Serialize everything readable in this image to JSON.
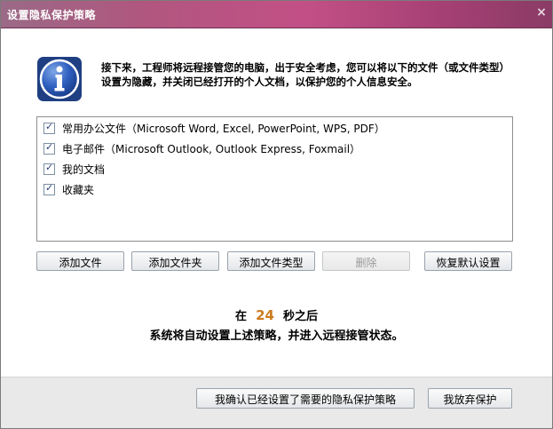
{
  "window": {
    "title": "设置隐私保护策略",
    "close_glyph": "×"
  },
  "info": {
    "icon": "info-icon",
    "message": "接下来，工程师将远程接管您的电脑，出于安全考虑，您可以将以下的文件（或文件类型）设置为隐藏，并关闭已经打开的个人文档，以保护您的个人信息安全。"
  },
  "list": {
    "items": [
      {
        "label": "常用办公文件（Microsoft Word, Excel, PowerPoint, WPS, PDF）",
        "checked": true
      },
      {
        "label": "电子邮件（Microsoft Outlook, Outlook Express, Foxmail）",
        "checked": true
      },
      {
        "label": "我的文档",
        "checked": true
      },
      {
        "label": "收藏夹",
        "checked": true
      }
    ]
  },
  "buttons": {
    "add_file": "添加文件",
    "add_folder": "添加文件夹",
    "add_file_type": "添加文件类型",
    "delete": "删除",
    "restore_default": "恢复默认设置"
  },
  "countdown": {
    "prefix": "在",
    "seconds": "24",
    "suffix": "秒之后",
    "message": "系统将自动设置上述策略，并进入远程接管状态。"
  },
  "footer": {
    "confirm": "我确认已经设置了需要的隐私保护策略",
    "abandon": "我放弃保护"
  },
  "colors": {
    "title_bar": "#c25086",
    "countdown_number": "#cc7a1e"
  }
}
